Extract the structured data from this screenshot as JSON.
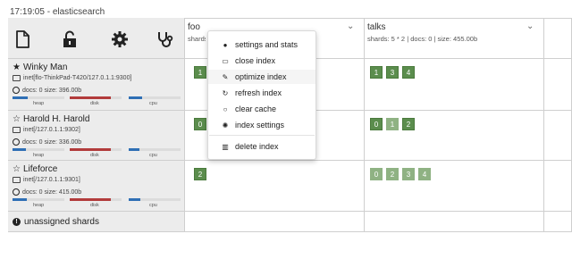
{
  "header": {
    "title": "17:19:05 - elasticsearch"
  },
  "toolbar": {
    "icons": [
      "document-icon",
      "unlock-icon",
      "gear-icon",
      "stethoscope-icon"
    ]
  },
  "indices": [
    {
      "name": "foo",
      "meta": "shards: 5 * 2 | docs: 0 | size: 0.00b"
    },
    {
      "name": "talks",
      "meta": "shards: 5 * 2 | docs: 0 | size: 455.00b"
    }
  ],
  "nodes": [
    {
      "name": "Winky Man",
      "star": "★",
      "address": "inet[flo-ThinkPad-T420/127.0.1.1:9300]",
      "stats": "docs: 0 size: 396.00b",
      "heap": 0.3,
      "disk": 0.8,
      "cpu": 0.25,
      "foo_shards": [
        "1"
      ],
      "talks_shards": [
        "1",
        "3",
        "4"
      ]
    },
    {
      "name": "Harold H. Harold",
      "star": "☆",
      "address": "inet[/127.0.1.1:9302]",
      "stats": "docs: 0 size: 336.00b",
      "heap": 0.25,
      "disk": 0.8,
      "cpu": 0.2,
      "foo_shards": [
        "0"
      ],
      "talks_shards": [
        "0",
        "1",
        "2"
      ]
    },
    {
      "name": "Lifeforce",
      "star": "☆",
      "address": "inet[/127.0.1.1:9301]",
      "stats": "docs: 0 size: 415.00b",
      "heap": 0.28,
      "disk": 0.8,
      "cpu": 0.22,
      "foo_shards": [
        "2"
      ],
      "talks_shards": [
        "0",
        "2",
        "3",
        "4"
      ]
    }
  ],
  "bar_labels": {
    "heap": "heap",
    "disk": "disk",
    "cpu": "cpu"
  },
  "unassigned": {
    "label": "unassigned shards"
  },
  "context_menu": {
    "items": [
      {
        "label": "settings and stats",
        "icon": "info-icon"
      },
      {
        "label": "close index",
        "icon": "folder-open-icon"
      },
      {
        "label": "optimize index",
        "icon": "wrench-icon"
      },
      {
        "label": "refresh index",
        "icon": "refresh-icon"
      },
      {
        "label": "clear cache",
        "icon": "circle-icon"
      },
      {
        "label": "index settings",
        "icon": "gear-icon"
      },
      {
        "label": "delete index",
        "icon": "trash-icon"
      }
    ]
  },
  "colors": {
    "primary_shard": "#5b8d4d",
    "replica_shard": "#8fb283",
    "heap": "#2f6fb5",
    "disk": "#b23b3b",
    "cpu": "#2f6fb5"
  }
}
